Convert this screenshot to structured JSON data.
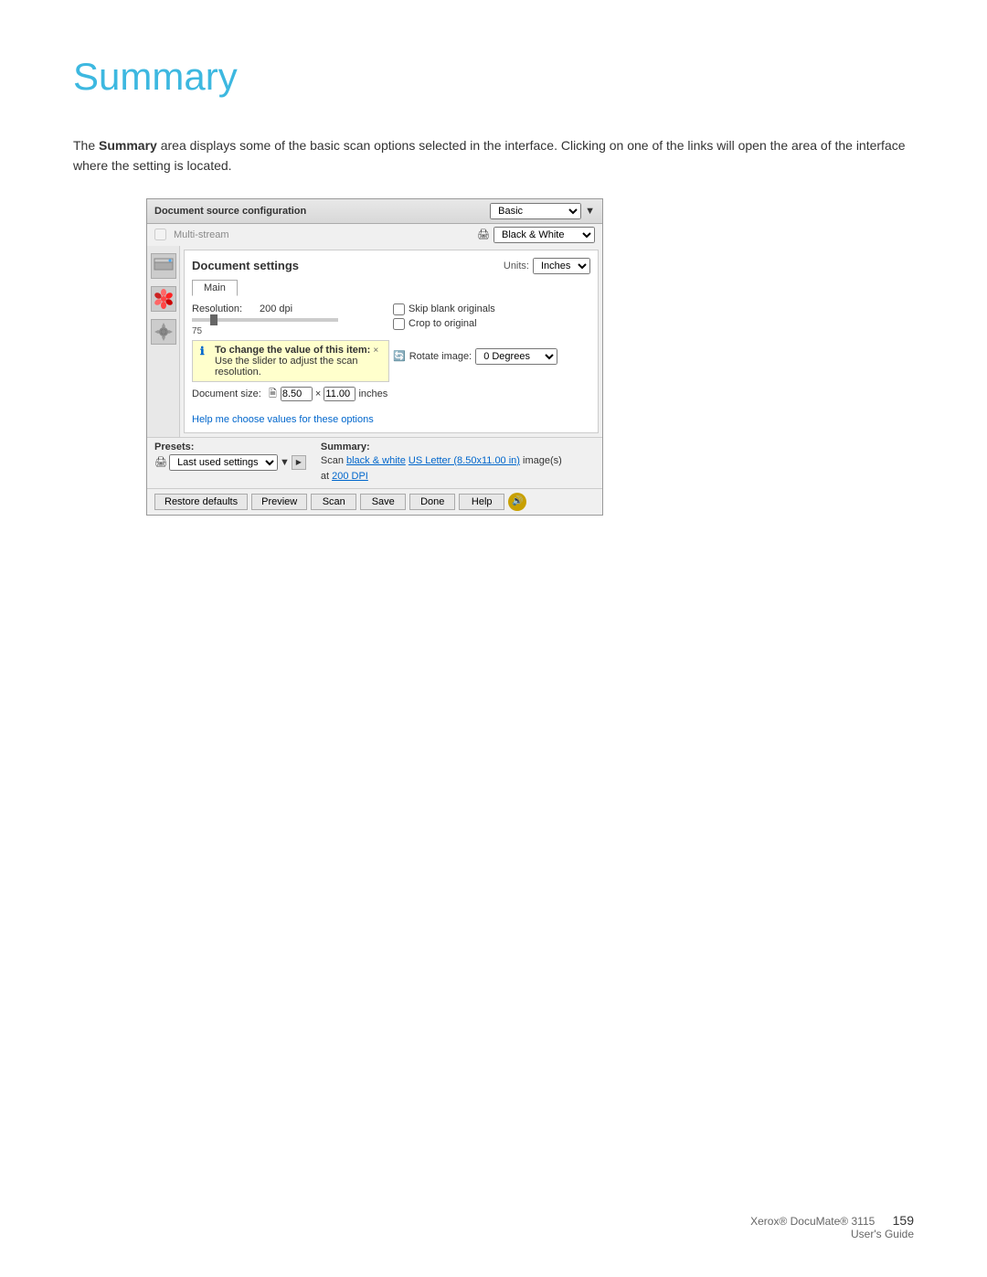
{
  "page": {
    "title": "Summary",
    "description_part1": "The ",
    "description_bold": "Summary",
    "description_part2": " area displays some of the basic scan options selected in the interface. Clicking on one of the links will open the area of the interface where the setting is located."
  },
  "dialog": {
    "title": "Document source configuration",
    "basic_label": "Basic",
    "multistream_label": "Multi-stream",
    "bw_option": "Black & White",
    "doc_settings_title": "Document settings",
    "units_label": "Units:",
    "units_value": "Inches",
    "tab_main": "Main",
    "resolution_label": "Resolution:",
    "resolution_value": "200 dpi",
    "skip_blank_label": "Skip blank originals",
    "crop_label": "Crop to original",
    "slider_min": "75",
    "tooltip_title": "To change the value of this item:",
    "tooltip_close": "×",
    "tooltip_body": "Use the slider to adjust the scan resolution.",
    "doc_size_label": "Document size:",
    "doc_size_value": "8.50",
    "doc_size_x": "×",
    "doc_size_height": "11.00",
    "doc_size_units": "inches",
    "rotate_label": "Rotate image:",
    "rotate_value": "0 Degrees",
    "help_link": "Help me choose values for these options",
    "presets_title": "Presets:",
    "presets_value": "Last used settings",
    "summary_title": "Summary:",
    "summary_text_scan": "Scan ",
    "summary_link1": "black & white",
    "summary_text2": " ",
    "summary_link2": "US Letter (8.50x11.00 in)",
    "summary_text3": " image(s)",
    "summary_text4": "at ",
    "summary_link3": "200 DPI",
    "btn_restore": "Restore defaults",
    "btn_preview": "Preview",
    "btn_scan": "Scan",
    "btn_save": "Save",
    "btn_done": "Done",
    "btn_help": "Help"
  },
  "footer": {
    "product": "Xerox® DocuMate® 3115",
    "guide": "User's Guide",
    "page_number": "159"
  }
}
